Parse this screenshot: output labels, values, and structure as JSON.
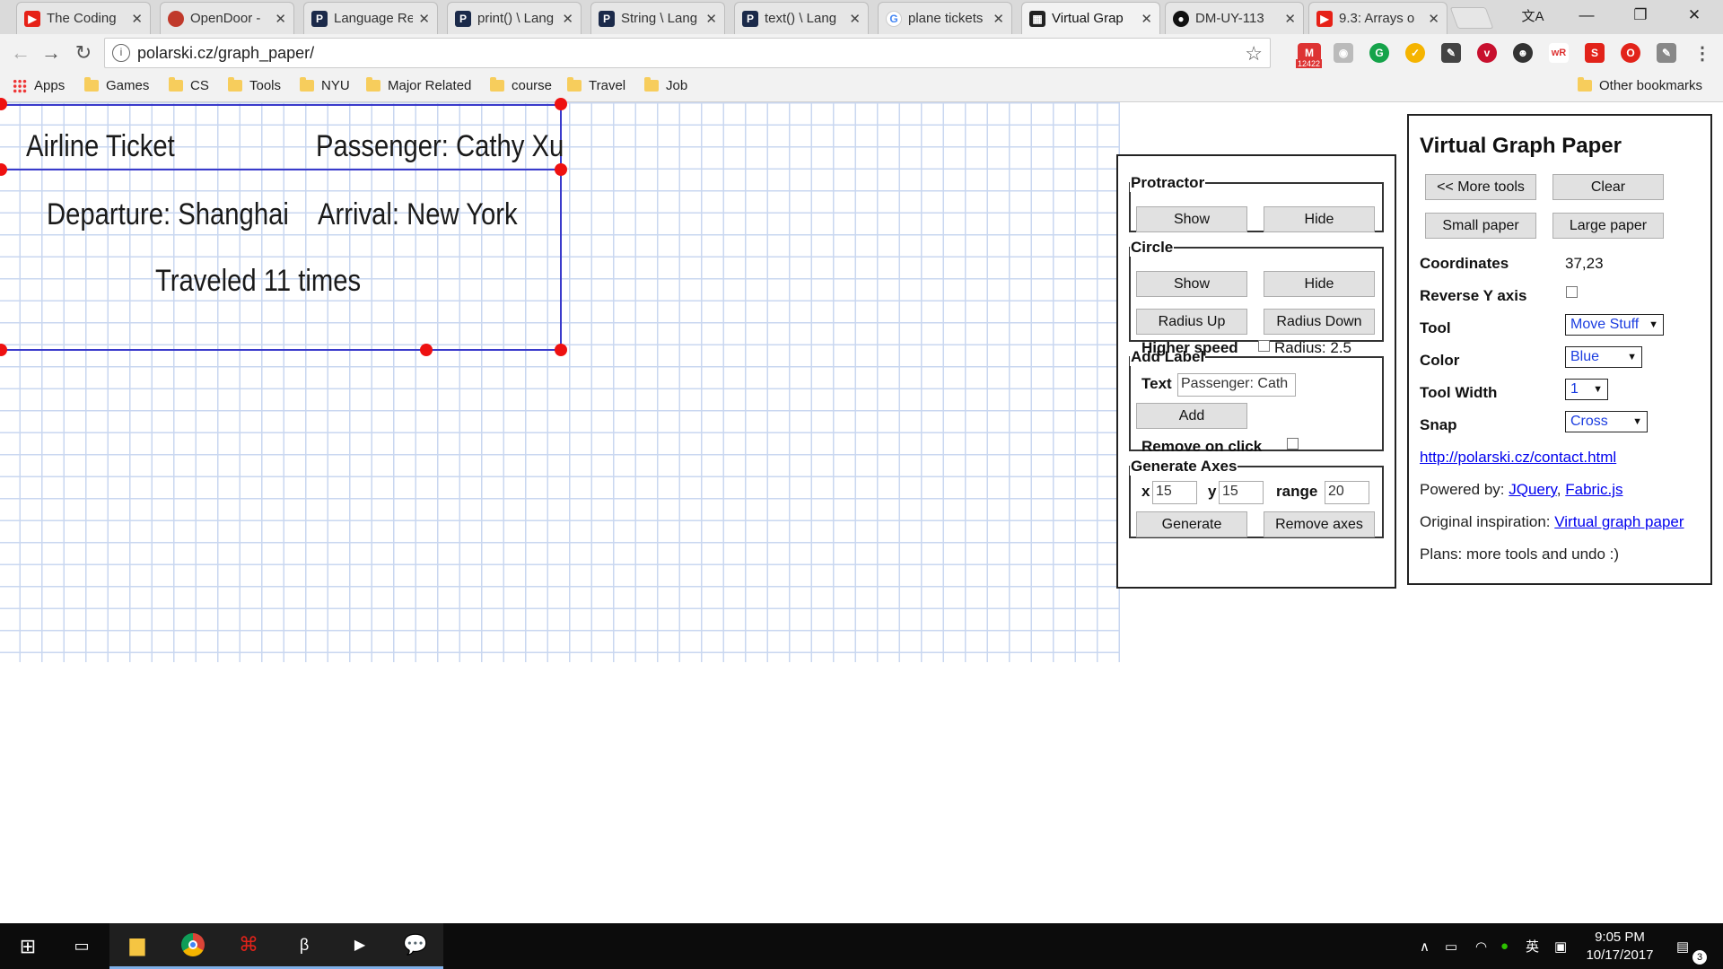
{
  "browser": {
    "tabs": [
      {
        "title": "The Coding",
        "icon": "youtube-icon",
        "color": "#e62117",
        "letter": "▶"
      },
      {
        "title": "OpenDoor -",
        "icon": "opendoor-icon",
        "color": "#c0392b",
        "letter": ""
      },
      {
        "title": "Language Re",
        "icon": "processing-icon",
        "color": "#1b2a4a",
        "letter": "P"
      },
      {
        "title": "print() \\ Lang",
        "icon": "processing-icon",
        "color": "#1b2a4a",
        "letter": "P"
      },
      {
        "title": "String \\ Lang",
        "icon": "processing-icon",
        "color": "#1b2a4a",
        "letter": "P"
      },
      {
        "title": "text() \\ Lang",
        "icon": "processing-icon",
        "color": "#1b2a4a",
        "letter": "P"
      },
      {
        "title": "plane tickets",
        "icon": "google-icon",
        "color": "#4285f4",
        "letter": "G"
      },
      {
        "title": "Virtual Grap",
        "icon": "graph-paper-icon",
        "color": "#222222",
        "letter": "▦"
      },
      {
        "title": "DM-UY-113",
        "icon": "github-icon",
        "color": "#111111",
        "letter": "●"
      },
      {
        "title": "9.3: Arrays o",
        "icon": "youtube-icon",
        "color": "#e62117",
        "letter": "▶"
      }
    ],
    "active_tab": 7,
    "url": "polarski.cz/graph_paper/",
    "gmail_count": "12422",
    "bookmarks": [
      "Apps",
      "Games",
      "CS",
      "Tools",
      "NYU",
      "Major Related",
      "course",
      "Travel",
      "Job"
    ],
    "other_bookmarks": "Other bookmarks"
  },
  "ticket": {
    "title": "Airline Ticket",
    "passenger": "Passenger: Cathy Xu",
    "departure": "Departure: Shanghai",
    "arrival": "Arrival: New York",
    "traveled": "Traveled 11 times"
  },
  "tools_panel": {
    "protractor": {
      "legend": "Protractor",
      "show": "Show",
      "hide": "Hide"
    },
    "circle": {
      "legend": "Circle",
      "show": "Show",
      "hide": "Hide",
      "radius_up": "Radius Up",
      "radius_down": "Radius Down",
      "higher_speed": "Higher speed",
      "radius": "Radius: 2.5"
    },
    "add_label": {
      "legend": "Add Label",
      "text_label": "Text",
      "text_value": "Passenger: Cath",
      "add": "Add",
      "remove_on_click": "Remove on click"
    },
    "generate_axes": {
      "legend": "Generate Axes",
      "x_label": "x",
      "x_value": "15",
      "y_label": "y",
      "y_value": "15",
      "range_label": "range",
      "range_value": "20",
      "generate": "Generate",
      "remove": "Remove axes"
    }
  },
  "main_panel": {
    "title": "Virtual Graph Paper",
    "more_tools": "<< More tools",
    "clear": "Clear",
    "small_paper": "Small paper",
    "large_paper": "Large paper",
    "coordinates_label": "Coordinates",
    "coordinates_value": "37,23",
    "reverse_y_label": "Reverse Y axis",
    "tool_label": "Tool",
    "tool_value": "Move Stuff",
    "color_label": "Color",
    "color_value": "Blue",
    "tool_width_label": "Tool Width",
    "tool_width_value": "1",
    "snap_label": "Snap",
    "snap_value": "Cross",
    "contact_link": "http://polarski.cz/contact.html",
    "powered_by": "Powered by:",
    "jquery": "JQuery",
    "comma": ",",
    "fabric": "Fabric.js",
    "inspiration": "Original inspiration:",
    "inspiration_link": "Virtual graph paper",
    "plans": "Plans: more tools and undo :)"
  },
  "taskbar": {
    "time": "9:05 PM",
    "date": "10/17/2017",
    "ime": "英",
    "notifications": "3"
  }
}
